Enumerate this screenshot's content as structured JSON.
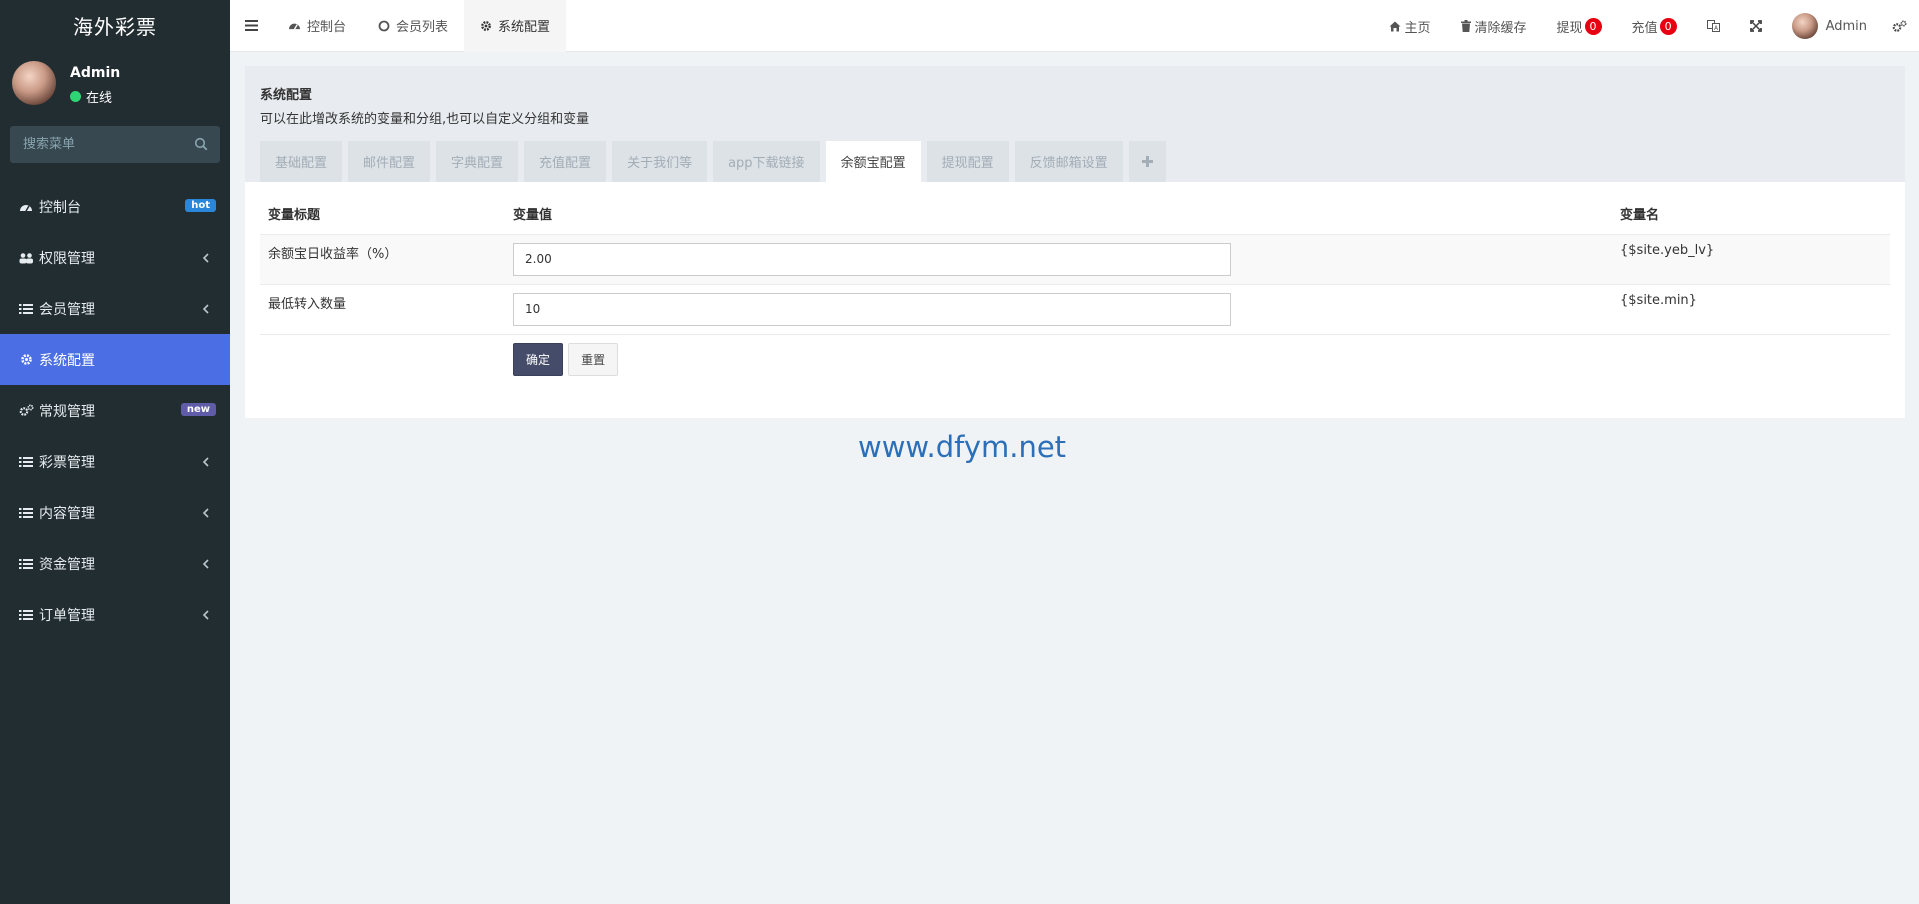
{
  "app": {
    "title": "海外彩票",
    "user": "Admin",
    "status": "在线",
    "search_placeholder": "搜索菜单"
  },
  "sidebar": {
    "items": [
      {
        "label": "控制台",
        "icon": "dashboard-icon",
        "badge": "hot"
      },
      {
        "label": "权限管理",
        "icon": "users-icon",
        "chevron": true
      },
      {
        "label": "会员管理",
        "icon": "list-icon",
        "chevron": true
      },
      {
        "label": "系统配置",
        "icon": "gear-icon",
        "active": true
      },
      {
        "label": "常规管理",
        "icon": "gears-icon",
        "badge": "new"
      },
      {
        "label": "彩票管理",
        "icon": "list-icon",
        "chevron": true
      },
      {
        "label": "内容管理",
        "icon": "list-icon",
        "chevron": true
      },
      {
        "label": "资金管理",
        "icon": "list-icon",
        "chevron": true
      },
      {
        "label": "订单管理",
        "icon": "list-icon",
        "chevron": true
      }
    ]
  },
  "topnav": {
    "tabs": [
      {
        "label": "控制台",
        "icon": "dashboard-icon"
      },
      {
        "label": "会员列表",
        "icon": "circle-icon"
      },
      {
        "label": "系统配置",
        "icon": "gear-icon",
        "active": true
      }
    ],
    "home": "主页",
    "clear_cache": "清除缓存",
    "withdraw": "提现",
    "withdraw_count": "0",
    "recharge": "充值",
    "recharge_count": "0",
    "user": "Admin"
  },
  "panel": {
    "title": "系统配置",
    "description": "可以在此增改系统的变量和分组,也可以自定义分组和变量",
    "tabs": [
      "基础配置",
      "邮件配置",
      "字典配置",
      "充值配置",
      "关于我们等",
      "app下载链接",
      "余额宝配置",
      "提现配置",
      "反馈邮箱设置"
    ],
    "active_tab": "余额宝配置",
    "columns": [
      "变量标题",
      "变量值",
      "变量名"
    ],
    "rows": [
      {
        "title": "余额宝日收益率（%）",
        "value": "2.00",
        "name": "{$site.yeb_lv}"
      },
      {
        "title": "最低转入数量",
        "value": "10",
        "name": "{$site.min}"
      }
    ],
    "confirm": "确定",
    "reset": "重置"
  },
  "watermark": "www.dfym.net",
  "colors": {
    "sidebar_bg": "#222d32",
    "active_menu": "#4c6ee5",
    "confirm_btn": "#444c69",
    "badge_red": "#e60012"
  }
}
